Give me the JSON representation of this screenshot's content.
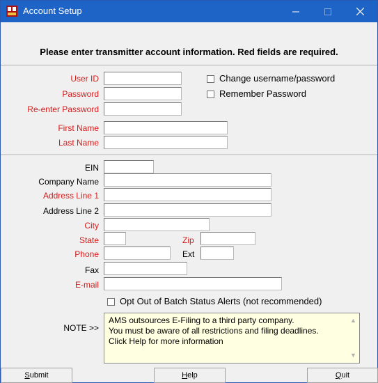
{
  "window": {
    "title": "Account Setup"
  },
  "heading": "Please enter transmitter account information.  Red fields are required.",
  "login": {
    "user_id_label": "User ID",
    "password_label": "Password",
    "reenter_label": "Re-enter Password",
    "first_name_label": "First Name",
    "last_name_label": "Last Name",
    "change_label": "Change username/password",
    "remember_label": "Remember Password"
  },
  "company": {
    "ein_label": "EIN",
    "company_label": "Company Name",
    "addr1_label": "Address Line 1",
    "addr2_label": "Address Line 2",
    "city_label": "City",
    "state_label": "State",
    "zip_label": "Zip",
    "phone_label": "Phone",
    "ext_label": "Ext",
    "fax_label": "Fax",
    "email_label": "E-mail",
    "optout_label": "Opt Out of Batch Status Alerts (not recommended)"
  },
  "note": {
    "label": "NOTE >>",
    "lines": [
      "AMS outsources E-Filing to a third party company.",
      "You must be aware of all restrictions and filing deadlines.",
      "Click Help for more information"
    ]
  },
  "buttons": {
    "submit_first": "S",
    "submit_rest": "ubmit",
    "help_first": "H",
    "help_rest": "elp",
    "quit_first": "Q",
    "quit_rest": "uit"
  },
  "colors": {
    "required": "#d21d1d",
    "titlebar": "#1e63c6",
    "note_bg": "#ffffe1"
  },
  "icons": [
    "app-icon",
    "minimize-icon",
    "maximize-icon",
    "close-icon",
    "scroll-up-icon",
    "scroll-down-icon"
  ]
}
